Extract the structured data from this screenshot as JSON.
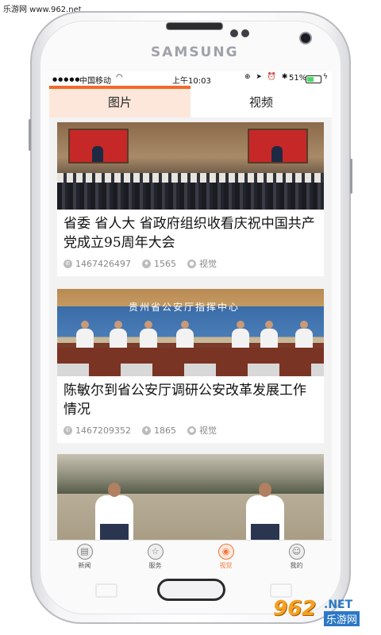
{
  "watermark": {
    "top_left": "乐游网 www.962.net",
    "logo_number": "962",
    "logo_net": ".NET",
    "logo_cn": "乐游网"
  },
  "device": {
    "brand": "SAMSUNG"
  },
  "statusbar": {
    "signal": "●●●●●",
    "carrier": "中国移动",
    "wifi_icon": "wifi-icon",
    "time": "上午10:03",
    "icons": "⊕ ➤ ⏰ ✱",
    "battery": "51%",
    "battery_level": 0.51
  },
  "tabs": [
    {
      "label": "图片",
      "active": true
    },
    {
      "label": "视频",
      "active": false
    }
  ],
  "articles": [
    {
      "title": "省委 省人大 省政府组织收看庆祝中国共产党成立95周年大会",
      "phone": "1467426497",
      "views": "1565",
      "location": "视觉"
    },
    {
      "title": "陈敏尔到省公安厅调研公安改革发展工作情况",
      "phone": "1467209352",
      "views": "1865",
      "location": "视觉",
      "banner": "贵州省公安厅指挥中心"
    },
    {
      "title": "",
      "phone": "",
      "views": "",
      "location": ""
    }
  ],
  "bottom_nav": [
    {
      "label": "新闻",
      "icon": "document-icon",
      "glyph": "▤",
      "active": false
    },
    {
      "label": "服务",
      "icon": "star-icon",
      "glyph": "☆",
      "active": false
    },
    {
      "label": "视觉",
      "icon": "eye-icon",
      "glyph": "◉",
      "active": true
    },
    {
      "label": "我的",
      "icon": "smiley-icon",
      "glyph": "☺",
      "active": false
    }
  ],
  "colors": {
    "accent": "#f06b2c",
    "tab_active_bg": "#fde7db",
    "nav_active": "#f07a3c"
  }
}
